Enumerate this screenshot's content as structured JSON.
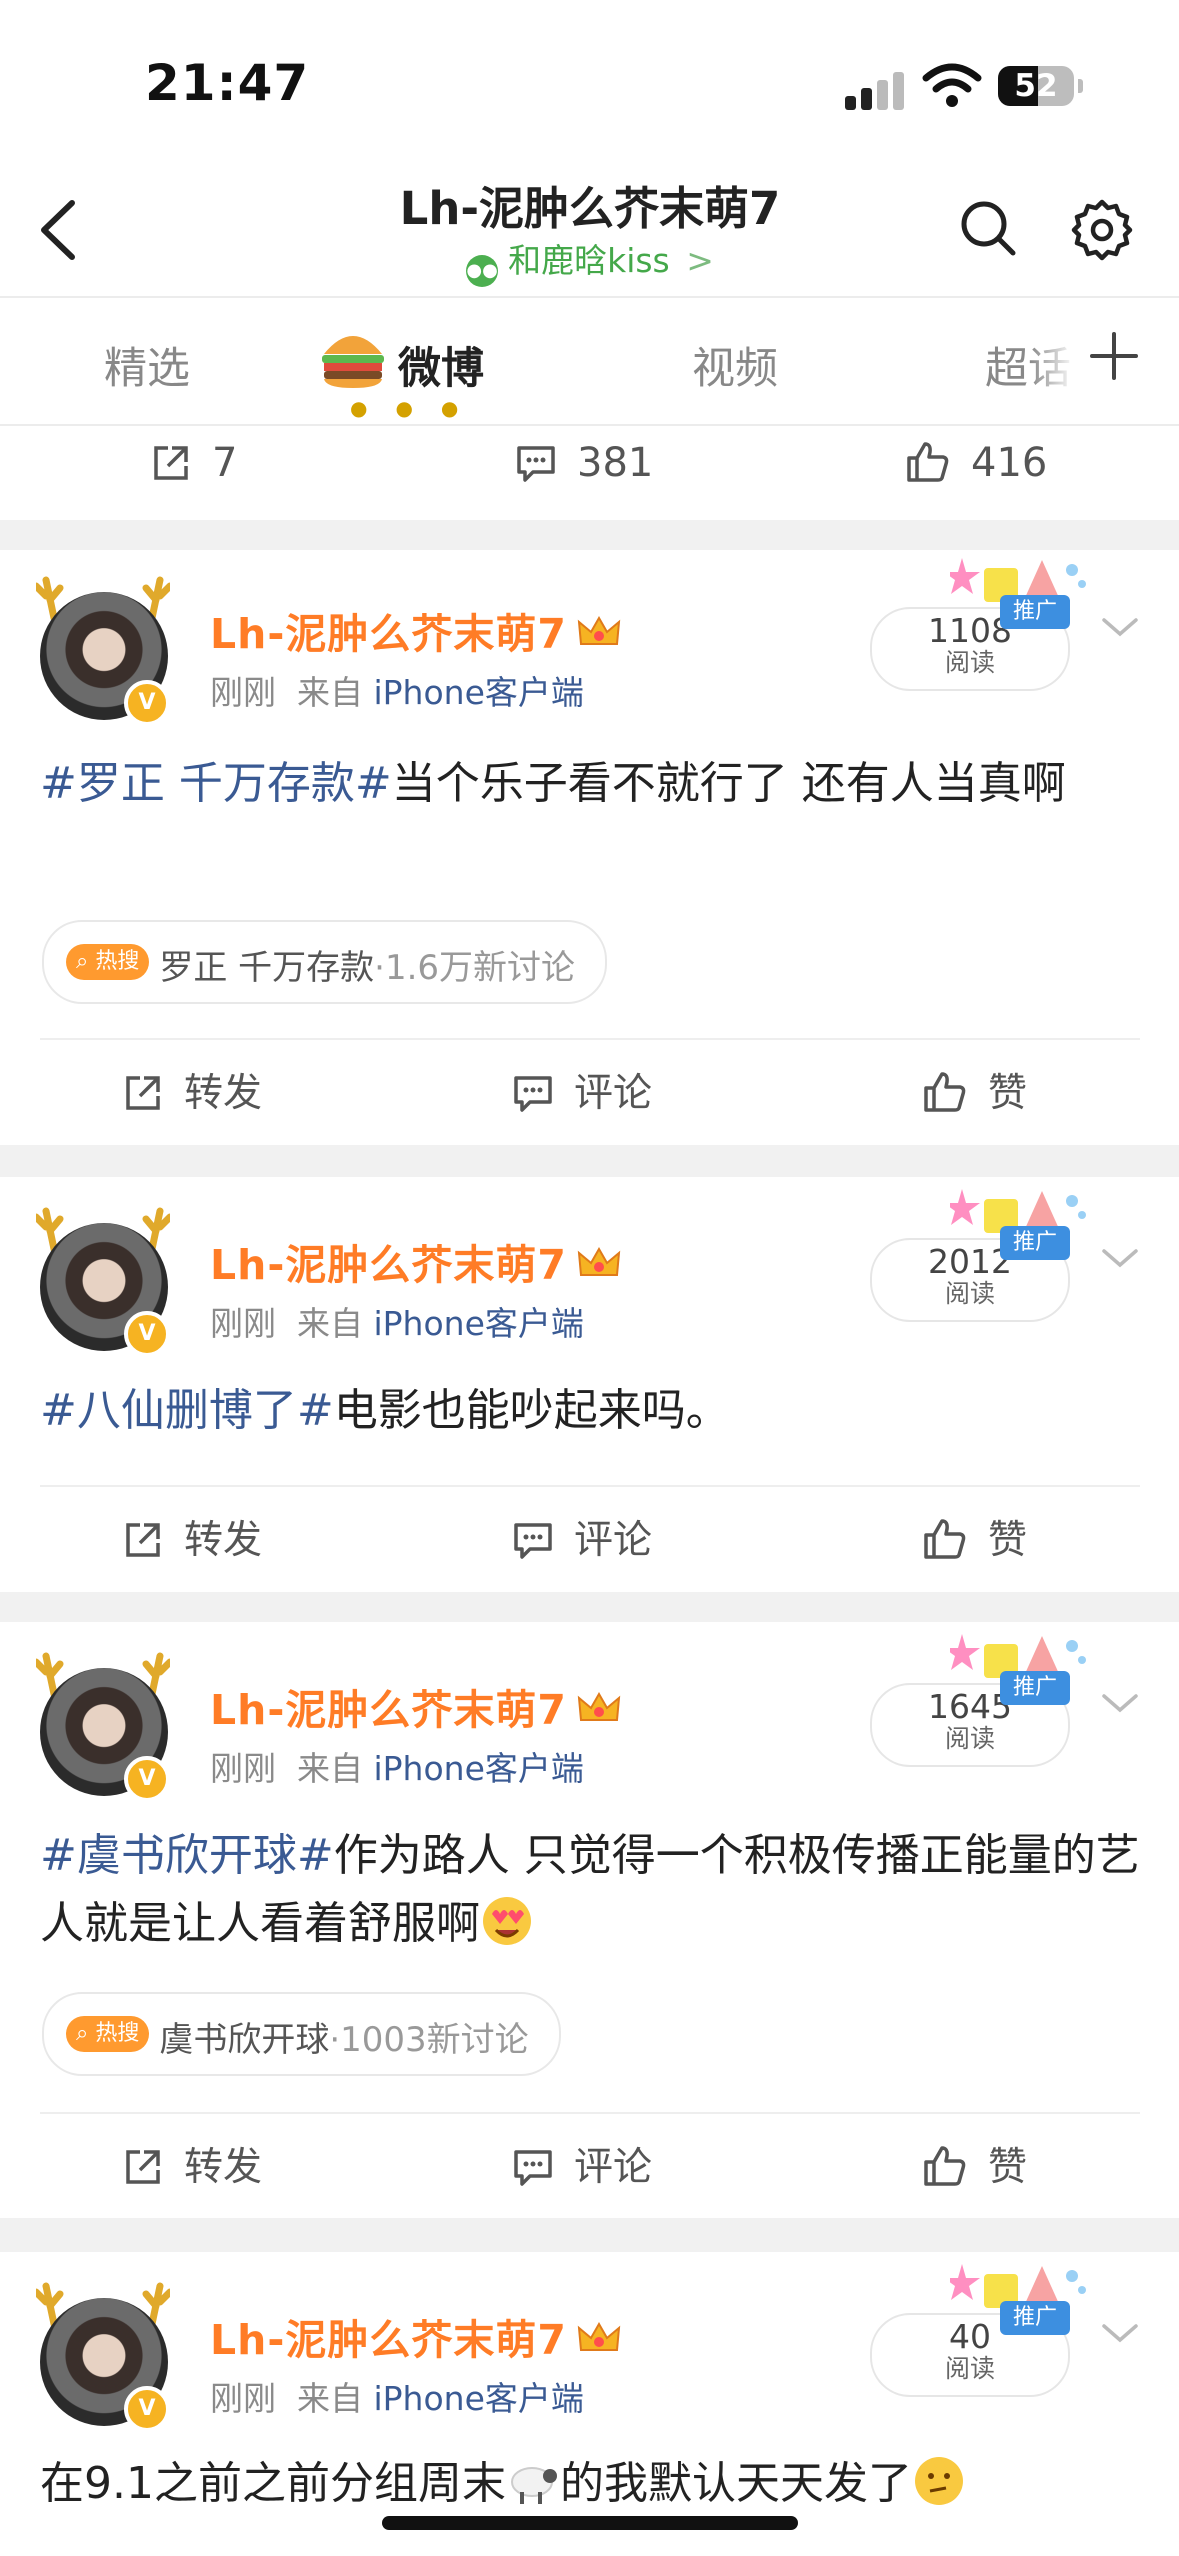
{
  "status_bar": {
    "time": "21:47",
    "battery": "52"
  },
  "nav": {
    "title": "Lh-泥肿么芥末萌7",
    "subtitle": "和鹿晗kiss",
    "subtitle_chevron": ">"
  },
  "tabs": [
    {
      "label": "精选"
    },
    {
      "label": "微博"
    },
    {
      "label": "视频"
    },
    {
      "label": "超话"
    }
  ],
  "prev_post_stats": {
    "reposts": "7",
    "comments": "381",
    "likes": "416"
  },
  "posts": [
    {
      "username": "Lh-泥肿么芥末萌7",
      "time": "刚刚",
      "source_prefix": "来自",
      "source": "iPhone客户端",
      "reads": "1108",
      "reads_label": "阅读",
      "promo_label": "推广",
      "hashtag": "#罗正 千万存款#",
      "body": "当个乐子看不就行了 还有人当真啊",
      "hot_badge": "热搜",
      "hot_topic": "罗正 千万存款",
      "hot_count": "·1.6万新讨论"
    },
    {
      "username": "Lh-泥肿么芥末萌7",
      "time": "刚刚",
      "source_prefix": "来自",
      "source": "iPhone客户端",
      "reads": "2012",
      "reads_label": "阅读",
      "promo_label": "推广",
      "hashtag": "#八仙删博了#",
      "body": "电影也能吵起来吗。"
    },
    {
      "username": "Lh-泥肿么芥末萌7",
      "time": "刚刚",
      "source_prefix": "来自",
      "source": "iPhone客户端",
      "reads": "1645",
      "reads_label": "阅读",
      "promo_label": "推广",
      "hashtag": "#虞书欣开球#",
      "body": "作为路人 只觉得一个积极传播正能量的艺人就是让人看着舒服啊",
      "hot_badge": "热搜",
      "hot_topic": "虞书欣开球",
      "hot_count": "·1003新讨论"
    },
    {
      "username": "Lh-泥肿么芥末萌7",
      "time": "刚刚",
      "source_prefix": "来自",
      "source": "iPhone客户端",
      "reads": "40",
      "reads_label": "阅读",
      "promo_label": "推广",
      "body_a": "在9.1之前之前分组周末",
      "body_b": "的我默认天天发了"
    }
  ],
  "actions": {
    "repost": "转发",
    "comment": "评论",
    "like": "赞"
  },
  "colors": {
    "username": "#ff7c26",
    "link": "#3a5a93",
    "hot_badge": "#ff9a2f",
    "promo": "#3d8fe0"
  }
}
